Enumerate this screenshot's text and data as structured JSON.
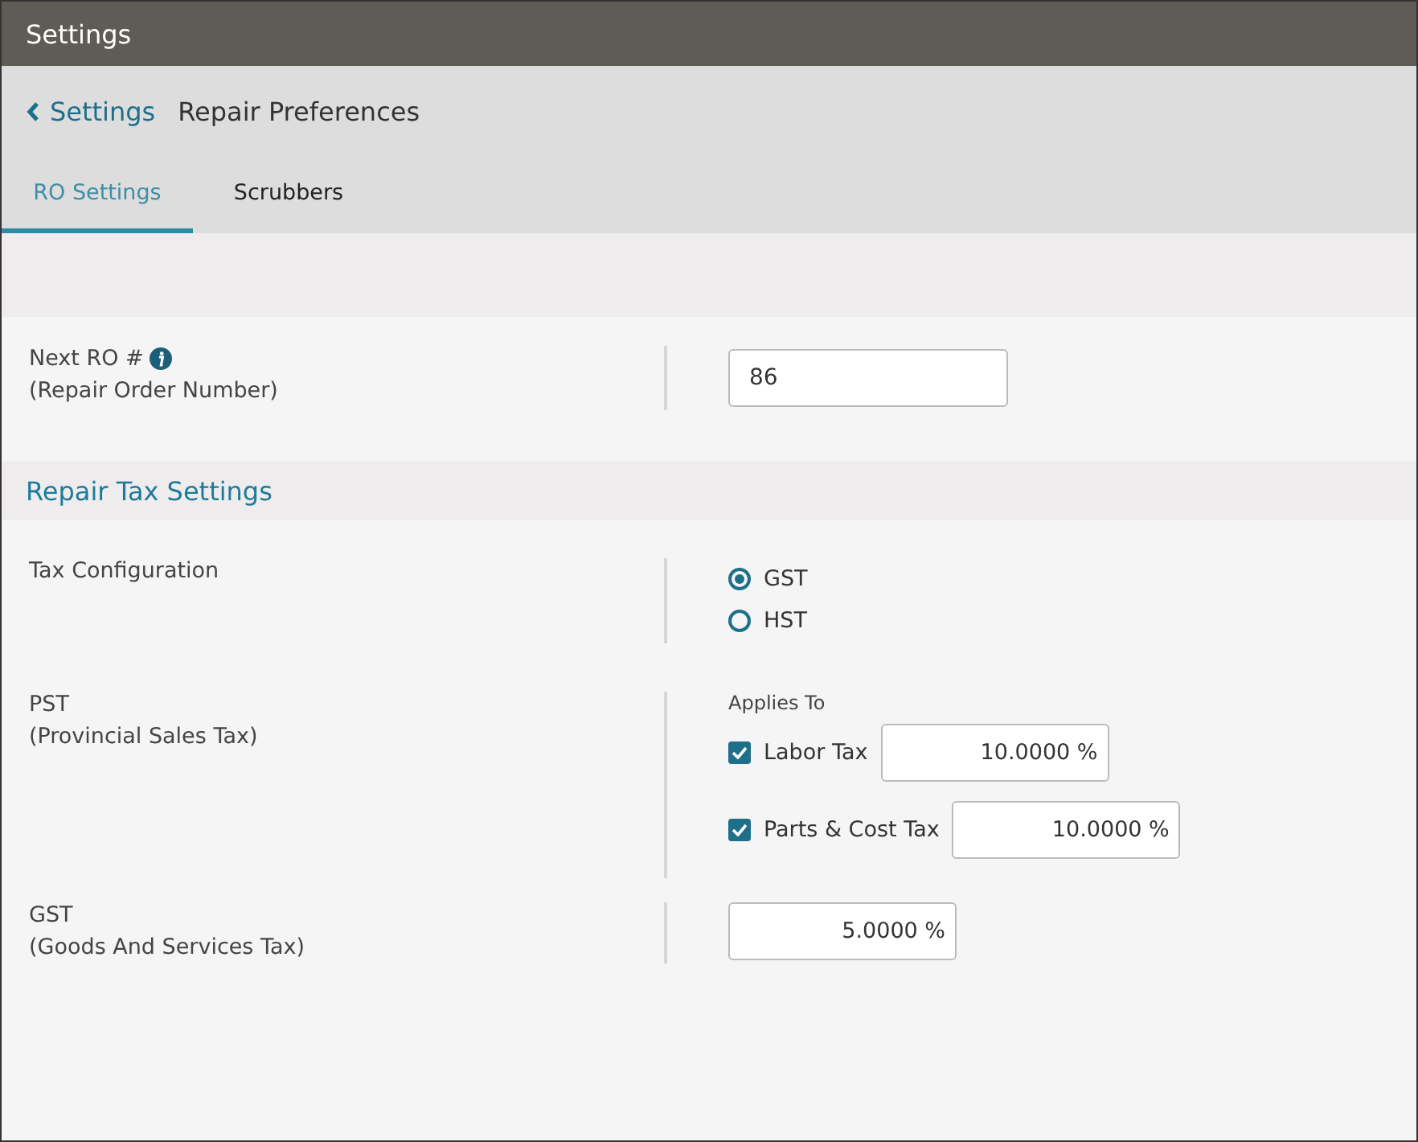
{
  "window": {
    "title": "Settings"
  },
  "breadcrumb": {
    "back": "Settings",
    "current": "Repair Preferences"
  },
  "tabs": [
    {
      "label": "RO Settings",
      "selected": true
    },
    {
      "label": "Scrubbers",
      "selected": false
    }
  ],
  "next_ro": {
    "label": "Next RO #",
    "sublabel": "(Repair Order Number)",
    "value": "86"
  },
  "section": {
    "title": "Repair Tax Settings"
  },
  "tax_configuration": {
    "label": "Tax Configuration",
    "options": [
      {
        "label": "GST",
        "selected": true
      },
      {
        "label": "HST",
        "selected": false
      }
    ]
  },
  "pst": {
    "label": "PST",
    "sublabel": "(Provincial Sales Tax)",
    "applies_to": "Applies To",
    "items": [
      {
        "label": "Labor Tax",
        "checked": true,
        "value": "10.0000",
        "unit": "%"
      },
      {
        "label": "Parts & Cost Tax",
        "checked": true,
        "value": "10.0000",
        "unit": "%"
      }
    ]
  },
  "gst": {
    "label": "GST",
    "sublabel": "(Goods And Services Tax)",
    "value": "5.0000",
    "unit": "%"
  }
}
